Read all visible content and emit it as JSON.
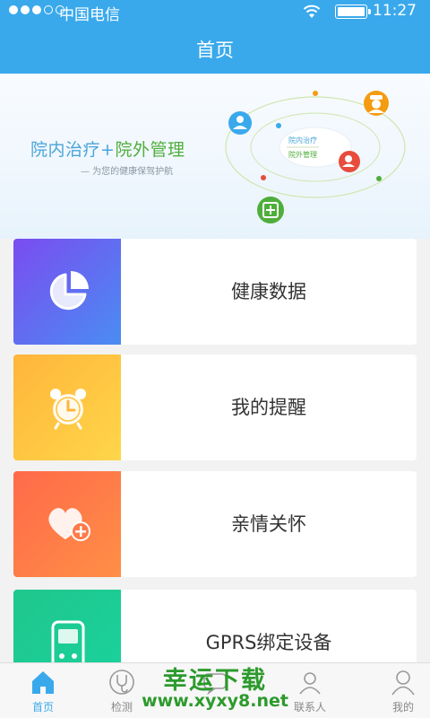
{
  "status_bar": {
    "carrier": "中国电信",
    "time": "11:27",
    "signal_strength": 3,
    "battery_level": 1.0
  },
  "header": {
    "title": "首页"
  },
  "banner": {
    "headline_part1": "院内治疗",
    "headline_plus": "+",
    "headline_part2": "院外管理",
    "subtitle": "— 为您的健康保驾护航",
    "center_line1": "院内治疗",
    "center_line2": "院外管理"
  },
  "menu": [
    {
      "label": "健康数据",
      "icon": "pie-chart-icon"
    },
    {
      "label": "我的提醒",
      "icon": "alarm-clock-icon"
    },
    {
      "label": "亲情关怀",
      "icon": "heart-plus-icon"
    },
    {
      "label": "GPRS绑定设备",
      "icon": "device-icon"
    }
  ],
  "tabs": [
    {
      "label": "首页",
      "icon": "home-icon",
      "active": true
    },
    {
      "label": "检测",
      "icon": "stethoscope-icon",
      "active": false
    },
    {
      "label": "",
      "icon": "message-icon",
      "active": false
    },
    {
      "label": "联系人",
      "icon": "contacts-icon",
      "active": false
    },
    {
      "label": "我的",
      "icon": "person-icon",
      "active": false
    }
  ],
  "watermark": {
    "line1": "幸运下载",
    "line2": "www.xyxy8.net"
  },
  "colors": {
    "primary": "#3aa9ec",
    "green": "#4fae3b"
  }
}
